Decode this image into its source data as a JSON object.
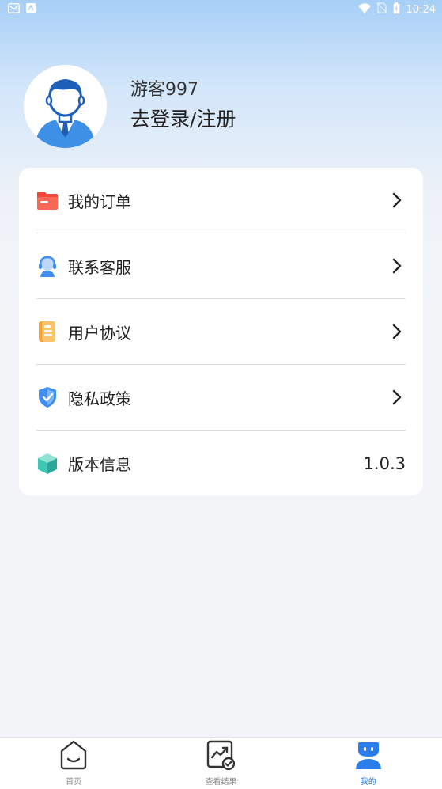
{
  "status_bar": {
    "time": "10:24",
    "left_icons": [
      "notification-icon",
      "app-icon"
    ],
    "right_icons": [
      "wifi-icon",
      "no-sim-icon",
      "battery-icon"
    ]
  },
  "profile": {
    "username": "游客997",
    "login_text": "去登录/注册",
    "avatar": "user-avatar-icon"
  },
  "menu": {
    "items": [
      {
        "label": "我的订单",
        "icon": "order-folder-icon",
        "color": "#f0473c"
      },
      {
        "label": "联系客服",
        "icon": "customer-service-icon",
        "color": "#3f8ff2"
      },
      {
        "label": "用户协议",
        "icon": "agreement-doc-icon",
        "color": "#f7a234"
      },
      {
        "label": "隐私政策",
        "icon": "privacy-shield-icon",
        "color": "#3f8ff2"
      },
      {
        "label": "版本信息",
        "icon": "version-cube-icon",
        "color": "#3fc7b5",
        "value": "1.0.3"
      }
    ]
  },
  "bottom_nav": {
    "tabs": [
      {
        "label": "首页",
        "icon": "home-icon",
        "active": false
      },
      {
        "label": "查看结果",
        "icon": "results-chart-icon",
        "active": false
      },
      {
        "label": "我的",
        "icon": "profile-icon",
        "active": true
      }
    ],
    "accent": "#2b7de9"
  }
}
